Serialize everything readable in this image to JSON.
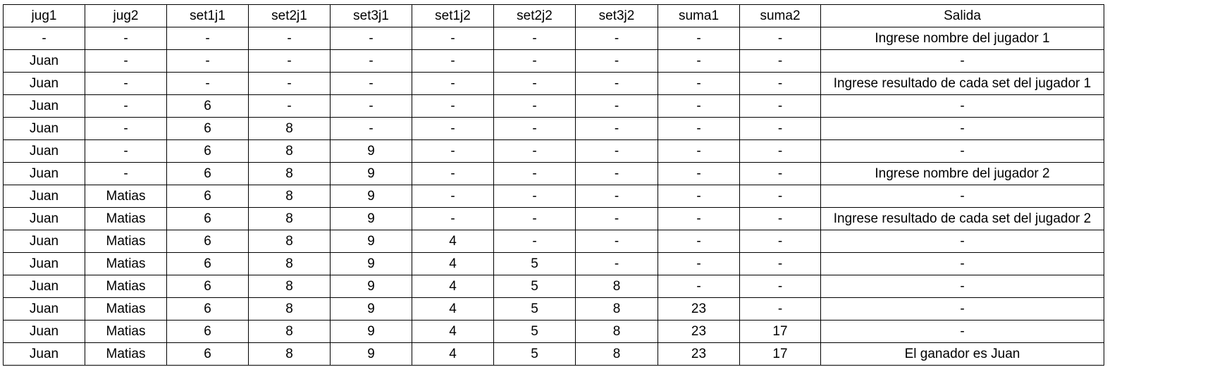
{
  "table": {
    "headers": [
      "jug1",
      "jug2",
      "set1j1",
      "set2j1",
      "set3j1",
      "set1j2",
      "set2j2",
      "set3j2",
      "suma1",
      "suma2",
      "Salida"
    ],
    "rows": [
      [
        "-",
        "-",
        "-",
        "-",
        "-",
        "-",
        "-",
        "-",
        "-",
        "-",
        "Ingrese nombre del jugador 1"
      ],
      [
        "Juan",
        "-",
        "-",
        "-",
        "-",
        "-",
        "-",
        "-",
        "-",
        "-",
        "-"
      ],
      [
        "Juan",
        "-",
        "-",
        "-",
        "-",
        "-",
        "-",
        "-",
        "-",
        "-",
        "Ingrese resultado de cada set del jugador 1"
      ],
      [
        "Juan",
        "-",
        "6",
        "-",
        "-",
        "-",
        "-",
        "-",
        "-",
        "-",
        "-"
      ],
      [
        "Juan",
        "-",
        "6",
        "8",
        "-",
        "-",
        "-",
        "-",
        "-",
        "-",
        "-"
      ],
      [
        "Juan",
        "-",
        "6",
        "8",
        "9",
        "-",
        "-",
        "-",
        "-",
        "-",
        "-"
      ],
      [
        "Juan",
        "-",
        "6",
        "8",
        "9",
        "-",
        "-",
        "-",
        "-",
        "-",
        "Ingrese nombre del jugador 2"
      ],
      [
        "Juan",
        "Matias",
        "6",
        "8",
        "9",
        "-",
        "-",
        "-",
        "-",
        "-",
        "-"
      ],
      [
        "Juan",
        "Matias",
        "6",
        "8",
        "9",
        "-",
        "-",
        "-",
        "-",
        "-",
        "Ingrese resultado de cada set del jugador 2"
      ],
      [
        "Juan",
        "Matias",
        "6",
        "8",
        "9",
        "4",
        "-",
        "-",
        "-",
        "-",
        "-"
      ],
      [
        "Juan",
        "Matias",
        "6",
        "8",
        "9",
        "4",
        "5",
        "-",
        "-",
        "-",
        "-"
      ],
      [
        "Juan",
        "Matias",
        "6",
        "8",
        "9",
        "4",
        "5",
        "8",
        "-",
        "-",
        "-"
      ],
      [
        "Juan",
        "Matias",
        "6",
        "8",
        "9",
        "4",
        "5",
        "8",
        "23",
        "-",
        "-"
      ],
      [
        "Juan",
        "Matias",
        "6",
        "8",
        "9",
        "4",
        "5",
        "8",
        "23",
        "17",
        "-"
      ],
      [
        "Juan",
        "Matias",
        "6",
        "8",
        "9",
        "4",
        "5",
        "8",
        "23",
        "17",
        "El ganador es Juan"
      ]
    ]
  }
}
